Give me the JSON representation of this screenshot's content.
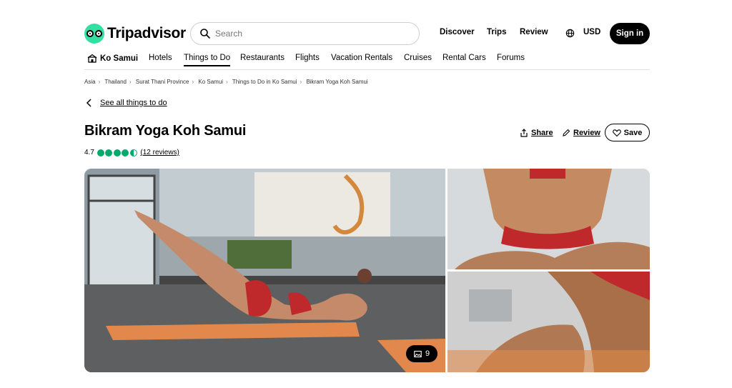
{
  "header": {
    "logo_text": "Tripadvisor",
    "search_placeholder": "Search",
    "nav": [
      "Discover",
      "Trips",
      "Review"
    ],
    "currency": "USD",
    "signin_label": "Sign in"
  },
  "subnav": {
    "location": "Ko Samui",
    "items": [
      "Hotels",
      "Things to Do",
      "Restaurants",
      "Flights",
      "Vacation Rentals",
      "Cruises",
      "Rental Cars",
      "Forums"
    ],
    "active": "Things to Do"
  },
  "breadcrumb": [
    "Asia",
    "Thailand",
    "Surat Thani Province",
    "Ko Samui",
    "Things to Do in Ko Samui",
    "Bikram Yoga Koh Samui"
  ],
  "back_link": "See all things to do",
  "listing": {
    "title": "Bikram Yoga Koh Samui",
    "rating": "4.7",
    "rating_value": 4.5,
    "reviews_label": "(12 reviews)"
  },
  "actions": {
    "share": "Share",
    "review": "Review",
    "save": "Save"
  },
  "gallery": {
    "photo_count": "9"
  },
  "colors": {
    "brand_green": "#34e0a1",
    "rating_green": "#00aa6c",
    "black": "#000000"
  },
  "icons": [
    "tripadvisor-owl-icon",
    "search-icon",
    "globe-icon",
    "location-icon",
    "chevron-left-icon",
    "share-icon",
    "pencil-icon",
    "heart-icon",
    "photo-icon"
  ]
}
